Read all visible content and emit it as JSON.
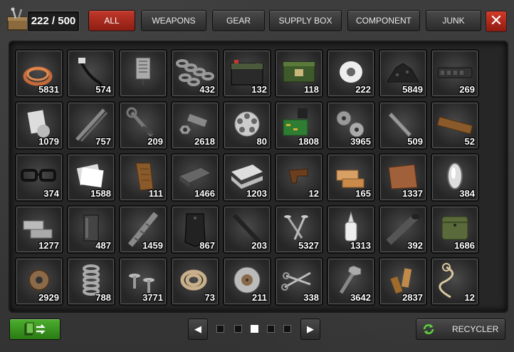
{
  "capacity": {
    "text": "222 / 500"
  },
  "tabs": [
    {
      "label": "ALL",
      "active": true
    },
    {
      "label": "WEAPONS",
      "active": false
    },
    {
      "label": "GEAR",
      "active": false
    },
    {
      "label": "SUPPLY BOX",
      "active": false
    },
    {
      "label": "COMPONENT",
      "active": false
    },
    {
      "label": "JUNK",
      "active": false
    }
  ],
  "close": {
    "label": "✕"
  },
  "items": [
    {
      "icon": "copper-coil-icon",
      "count": "5831"
    },
    {
      "icon": "cable-plug-icon",
      "count": "574"
    },
    {
      "icon": "circuit-chip-icon",
      "count": ""
    },
    {
      "icon": "chain-icon",
      "count": "432"
    },
    {
      "icon": "car-battery-icon",
      "count": "132"
    },
    {
      "icon": "ammo-crate-icon",
      "count": "118"
    },
    {
      "icon": "tape-roll-icon",
      "count": "222"
    },
    {
      "icon": "charcoal-pile-icon",
      "count": "5849"
    },
    {
      "icon": "rail-handguard-icon",
      "count": "269"
    },
    {
      "icon": "cloth-roll-icon",
      "count": "1079"
    },
    {
      "icon": "metal-rods-icon",
      "count": "757"
    },
    {
      "icon": "wrench-tool-icon",
      "count": "209"
    },
    {
      "icon": "bolts-nuts-icon",
      "count": "2618"
    },
    {
      "icon": "revolver-cylinder-icon",
      "count": "80"
    },
    {
      "icon": "circuit-board-icon",
      "count": "1808"
    },
    {
      "icon": "screws-icon",
      "count": "3965"
    },
    {
      "icon": "blade-icon",
      "count": "509"
    },
    {
      "icon": "wood-plank-icon",
      "count": "52"
    },
    {
      "icon": "glasses-icon",
      "count": "374"
    },
    {
      "icon": "paper-stack-icon",
      "count": "1588"
    },
    {
      "icon": "pistol-grip-icon",
      "count": "111"
    },
    {
      "icon": "whetstone-icon",
      "count": "1466"
    },
    {
      "icon": "folded-cloth-icon",
      "count": "1203"
    },
    {
      "icon": "trigger-part-icon",
      "count": "12"
    },
    {
      "icon": "wood-blocks-icon",
      "count": "165"
    },
    {
      "icon": "leather-piece-icon",
      "count": "1337"
    },
    {
      "icon": "lens-icon",
      "count": "384"
    },
    {
      "icon": "concrete-blocks-icon",
      "count": "1277"
    },
    {
      "icon": "magazine-icon",
      "count": "487"
    },
    {
      "icon": "rebar-icon",
      "count": "1459"
    },
    {
      "icon": "armor-plate-icon",
      "count": "867"
    },
    {
      "icon": "iron-bar-icon",
      "count": "203"
    },
    {
      "icon": "nails-icon",
      "count": "5327"
    },
    {
      "icon": "glue-bottle-icon",
      "count": "1313"
    },
    {
      "icon": "metal-pipe-icon",
      "count": "392"
    },
    {
      "icon": "pouch-icon",
      "count": "1686"
    },
    {
      "icon": "gear-cog-icon",
      "count": "2929"
    },
    {
      "icon": "spring-icon",
      "count": "788"
    },
    {
      "icon": "rivets-icon",
      "count": "3771"
    },
    {
      "icon": "rope-coil-icon",
      "count": "73"
    },
    {
      "icon": "saw-blade-icon",
      "count": "211"
    },
    {
      "icon": "scissors-icon",
      "count": "338"
    },
    {
      "icon": "screw-bolt-icon",
      "count": "3642"
    },
    {
      "icon": "bullet-casings-icon",
      "count": "2837"
    },
    {
      "icon": "string-cord-icon",
      "count": "12"
    }
  ],
  "pager": {
    "prev": "◀",
    "next": "▶",
    "pages": 5,
    "current": 3
  },
  "recycler": {
    "label": "RECYCLER"
  },
  "colors": {
    "accent_red": "#b02a1c",
    "accent_green": "#3c9a22"
  }
}
